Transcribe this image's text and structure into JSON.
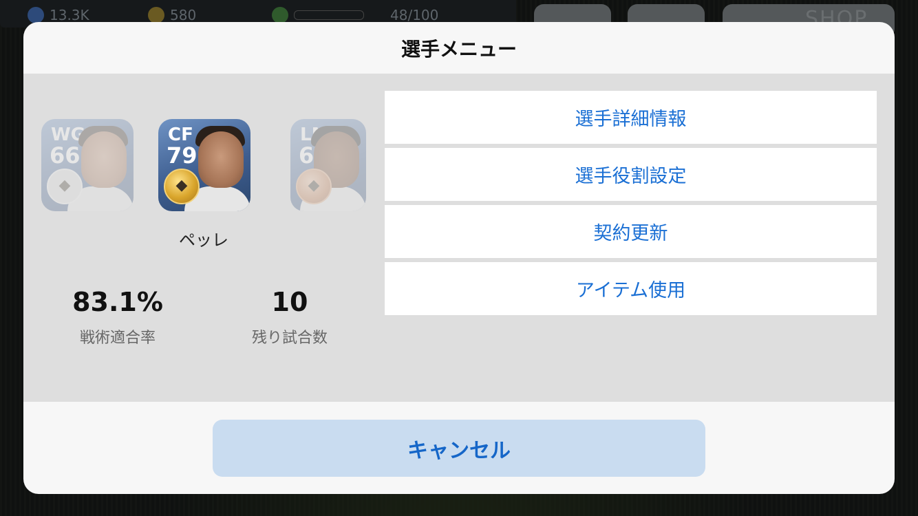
{
  "hud": {
    "stat1": "13.3K",
    "stat2": "580",
    "stat3": "48/100",
    "shop_label": "SHOP"
  },
  "modal": {
    "title": "選手メニュー",
    "players": [
      {
        "position": "WG",
        "rating": "66"
      },
      {
        "position": "CF",
        "rating": "79",
        "name": "ペッレ"
      },
      {
        "position": "LMF",
        "rating": "60"
      }
    ],
    "stats": [
      {
        "value": "83.1%",
        "label": "戦術適合率"
      },
      {
        "value": "10",
        "label": "残り試合数"
      }
    ],
    "menu_items": [
      {
        "label": "選手詳細情報"
      },
      {
        "label": "選手役割設定"
      },
      {
        "label": "契約更新"
      },
      {
        "label": "アイテム使用"
      }
    ],
    "cancel_label": "キャンセル"
  },
  "colors": {
    "accent": "#1a6fd4",
    "cancel_bg": "#c9dcf0",
    "card_blue": "#3d5d8f"
  }
}
